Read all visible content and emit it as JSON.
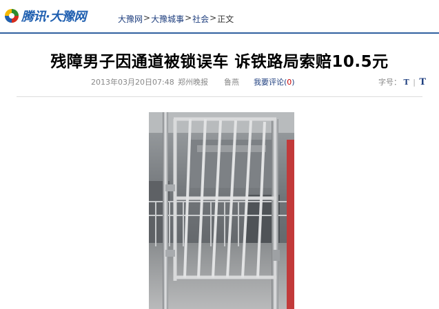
{
  "header": {
    "logo_text": "腾讯·大豫网",
    "logo_icon": "tencent-qq-logo-icon",
    "brand_color": "#1f5fb0",
    "breadcrumb": [
      {
        "label": "大豫网"
      },
      {
        "label": "大豫城事"
      },
      {
        "label": "社会"
      },
      {
        "label": "正文"
      }
    ],
    "breadcrumb_separator": ">"
  },
  "article": {
    "title": "残障男子因通道被锁误车 诉铁路局索赔10.5元",
    "date": "2013年03月20日07:48",
    "source": "郑州晚报",
    "author": "鲁燕",
    "comment_label": "我要评论",
    "comment_count_open": "(",
    "comment_count": "0",
    "comment_count_close": ")",
    "font_size_label": "字号：",
    "font_small": "T",
    "font_separator": "|",
    "font_large": "T"
  },
  "photo": {
    "icon": "locked-metal-gate-photo"
  },
  "colors": {
    "link": "#1f3f7f",
    "comment_count": "#cc0000",
    "meta_gray": "#888888"
  }
}
